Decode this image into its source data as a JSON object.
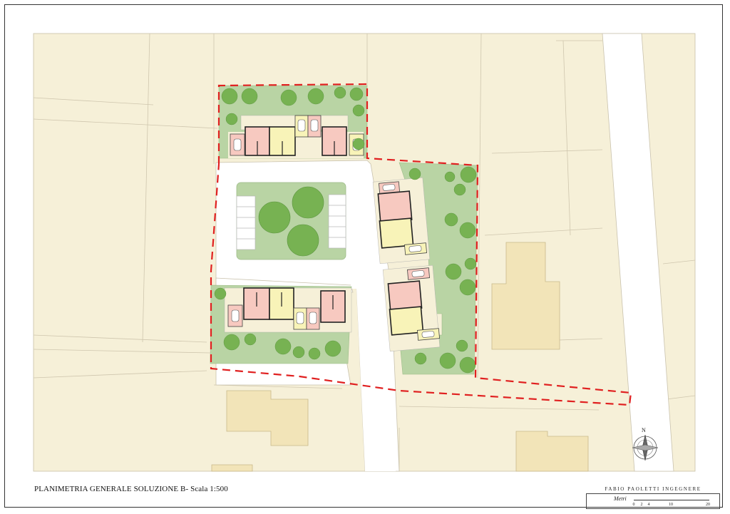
{
  "drawing_title": "PLANIMETRIA GENERALE SOLUZIONE B- Scala 1:500",
  "title_block": {
    "firm": "FABIO PAOLETTI INGEGNERE",
    "scale_unit": "Metri",
    "scale_ticks": [
      "0",
      "2",
      "4",
      "10",
      "20"
    ]
  },
  "north_label": "N",
  "colors": {
    "background_parcels": "#f6f0d8",
    "building_footprint": "#f2e4b8",
    "road": "#ffffff",
    "green_area": "#b9d4a4",
    "tree": "#77b252",
    "unit_pink": "#f7c9c0",
    "unit_yellow": "#f8f3b8",
    "site_boundary": "#e02020",
    "walls": "#222222"
  }
}
